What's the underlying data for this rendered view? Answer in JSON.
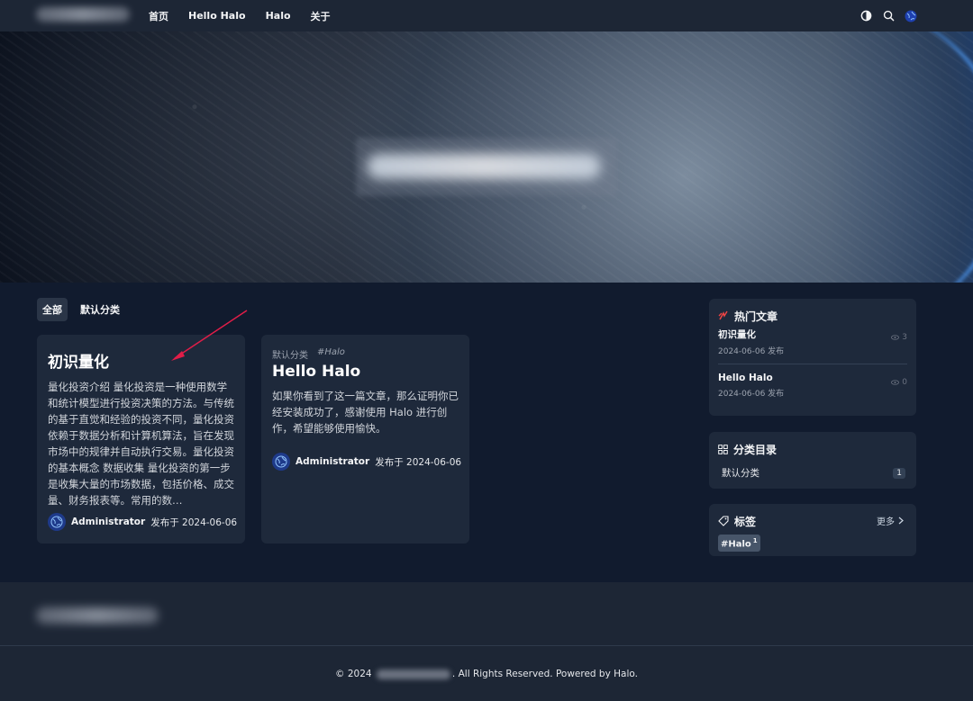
{
  "nav": {
    "menu": [
      "首页",
      "Hello Halo",
      "Halo",
      "关于"
    ],
    "icons": [
      "theme-toggle-icon",
      "search-icon",
      "globe-icon"
    ]
  },
  "tabs": [
    {
      "label": "全部",
      "active": true
    },
    {
      "label": "默认分类",
      "active": false
    }
  ],
  "posts": [
    {
      "title": "初识量化",
      "excerpt": "量化投资介绍 量化投资是一种使用数学和统计模型进行投资决策的方法。与传统的基于直觉和经验的投资不同，量化投资依赖于数据分析和计算机算法，旨在发现市场中的规律并自动执行交易。量化投资的基本概念 数据收集 量化投资的第一步是收集大量的市场数据，包括价格、成交量、财务报表等。常用的数…",
      "author": "Administrator",
      "date": "发布于 2024-06-06"
    },
    {
      "category": "默认分类",
      "tag": "#Halo",
      "title": "Hello Halo",
      "excerpt": "如果你看到了这一篇文章，那么证明你已经安装成功了，感谢使用 Halo 进行创作，希望能够使用愉快。",
      "author": "Administrator",
      "date": "发布于 2024-06-06"
    }
  ],
  "sidebar": {
    "hot": {
      "title": "热门文章",
      "items": [
        {
          "title": "初识量化",
          "date": "2024-06-06 发布",
          "views": "3"
        },
        {
          "title": "Hello Halo",
          "date": "2024-06-06 发布",
          "views": "0"
        }
      ]
    },
    "categories": {
      "title": "分类目录",
      "items": [
        {
          "name": "默认分类",
          "count": "1"
        }
      ]
    },
    "tags": {
      "title": "标签",
      "more": "更多",
      "items": [
        {
          "name": "#Halo",
          "count": "1"
        }
      ]
    }
  },
  "footer": {
    "copyright_prefix": "© 2024",
    "copyright_suffix": ". All Rights Reserved. Powered by Halo."
  },
  "colors": {
    "accent": "#3b82f6",
    "hot_icon": "#ef4444",
    "annotation": "#e11d48"
  }
}
